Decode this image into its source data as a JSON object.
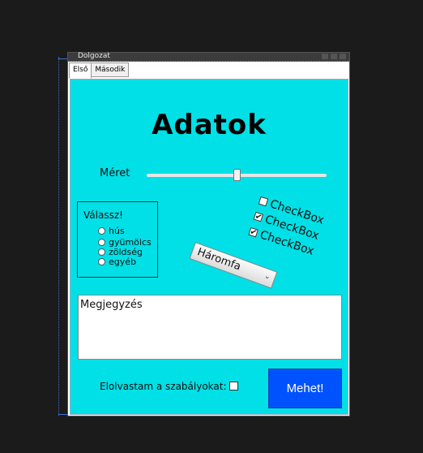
{
  "window": {
    "title": "Dolgozat",
    "tabs": [
      {
        "label": "Első",
        "active": true
      },
      {
        "label": "Második",
        "active": false
      }
    ]
  },
  "panel": {
    "background": "#00e0e6",
    "heading": "Adatok",
    "size": {
      "label": "Méret",
      "slider_value": 0.5
    },
    "choice_group": {
      "caption": "Válassz!",
      "options": [
        "hús",
        "gyümölcs",
        "zöldség",
        "egyéb"
      ]
    },
    "checkboxes": [
      {
        "label": "CheckBox",
        "checked": false
      },
      {
        "label": "CheckBox",
        "checked": true
      },
      {
        "label": "CheckBox",
        "checked": true
      }
    ],
    "combo": {
      "selected": "Háromfa"
    },
    "notes": {
      "value": "Megjegyzés"
    },
    "agree": {
      "label": "Elolvastam a szabályokat:",
      "checked": false
    },
    "submit": {
      "label": "Mehet!",
      "color": "#0052ff"
    }
  }
}
